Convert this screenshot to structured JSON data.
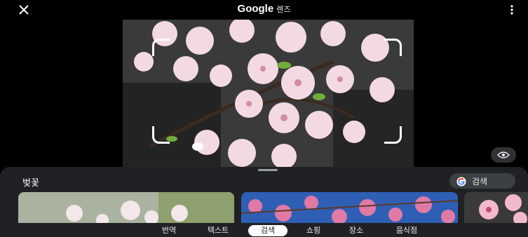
{
  "header": {
    "close_icon": "close-icon",
    "brand": "Google",
    "product": "렌즈",
    "menu_icon": "more-vert-icon"
  },
  "viewer": {
    "visual_search_icon": "eye-search-icon"
  },
  "results": {
    "title": "벚꽃",
    "search_button_label": "검색",
    "search_button_icon": "google-g-icon"
  },
  "tabs": [
    {
      "label": "번역",
      "active": false
    },
    {
      "label": "텍스트",
      "active": false
    },
    {
      "label": "검색",
      "active": true
    },
    {
      "label": "쇼핑",
      "active": false
    },
    {
      "label": "장소",
      "active": false
    },
    {
      "label": "음식점",
      "active": false
    }
  ],
  "colors": {
    "background": "#000000",
    "sheet": "#202124",
    "blossom": "#f3d9e2",
    "sky": "#2f5fb5"
  }
}
